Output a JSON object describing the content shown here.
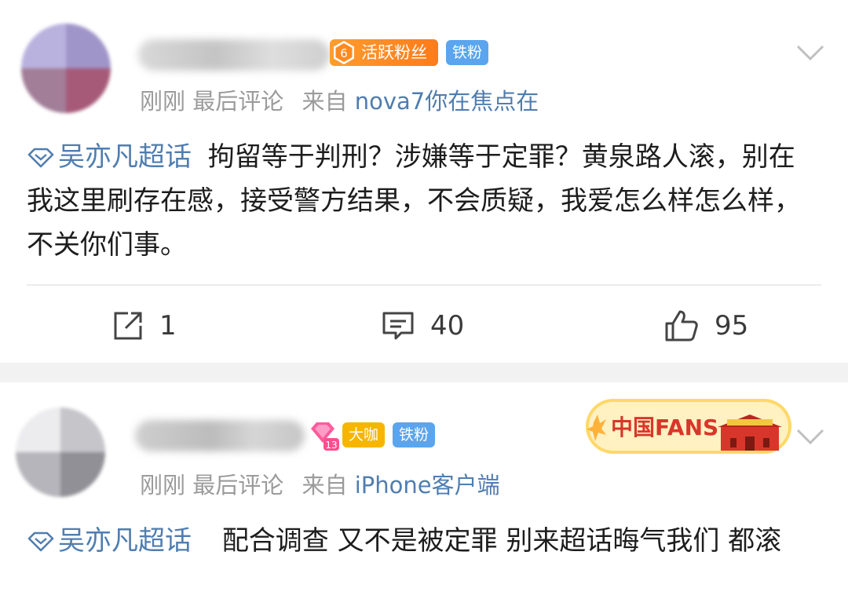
{
  "posts": [
    {
      "badges": {
        "fans_level": "6",
        "fans_label": "活跃粉丝",
        "tier": "铁粉"
      },
      "meta": {
        "time": "刚刚",
        "last_comment": "最后评论",
        "from": "来自",
        "source": "nova7你在焦点在"
      },
      "topic": "吴亦凡超话",
      "text": "拘留等于判刑？涉嫌等于定罪？黄泉路人滚，别在我这里刷存在感，接受警方结果，不会质疑，我爱怎么样怎么样，不关你们事。",
      "actions": {
        "share_count": "1",
        "comment_count": "40",
        "like_count": "95"
      }
    },
    {
      "badges": {
        "diamond_level": "13",
        "vip_label": "大咖",
        "tier": "铁粉"
      },
      "promo_label": "中国FANS",
      "meta": {
        "time": "刚刚",
        "last_comment": "最后评论",
        "from": "来自",
        "source": "iPhone客户端"
      },
      "topic": "吴亦凡超话",
      "text": "配合调查 又不是被定罪 别来超话晦气我们 都滚"
    }
  ],
  "colors": {
    "link": "#507daf",
    "meta": "#9b9b9b",
    "fans_badge": "#ff8a1f",
    "tier_badge": "#5aa5ee",
    "vip_badge": "#f7b500",
    "divider": "#f2f2f2"
  },
  "icons": [
    "chevron-down-icon",
    "diamond-topic-icon",
    "share-icon",
    "comment-icon",
    "like-icon",
    "fans-level-icon",
    "diamond-level-icon"
  ]
}
